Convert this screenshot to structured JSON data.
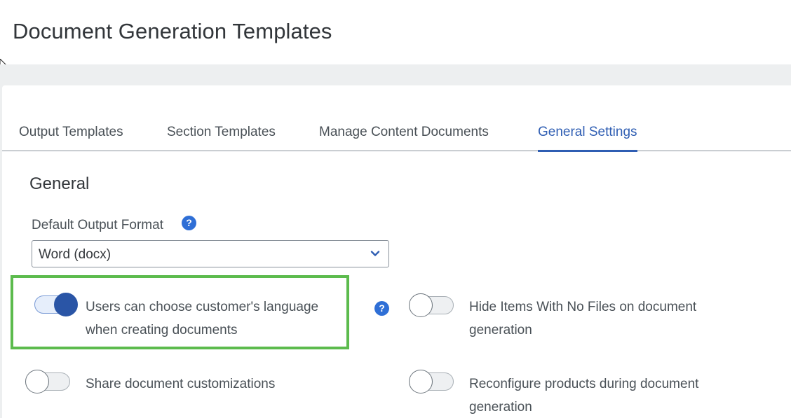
{
  "page": {
    "title": "Document Generation Templates"
  },
  "tabs": [
    {
      "label": "Output Templates",
      "active": false
    },
    {
      "label": "Section Templates",
      "active": false
    },
    {
      "label": "Manage Content Documents",
      "active": false
    },
    {
      "label": "General Settings",
      "active": true
    }
  ],
  "general": {
    "section_title": "General",
    "default_output_format": {
      "label": "Default Output Format",
      "value": "Word (docx)"
    },
    "options": {
      "choose_language": {
        "line1": "Users can choose customer's language",
        "line2": "when creating documents",
        "enabled": true
      },
      "hide_items": {
        "line1": "Hide Items With No Files on document",
        "line2": "generation",
        "enabled": false
      },
      "share_customizations": {
        "line1": "Share document customizations",
        "enabled": false
      },
      "reconfigure_products": {
        "line1": "Reconfigure products during document",
        "line2": "generation",
        "enabled": false
      }
    }
  },
  "colors": {
    "accent": "#2f5eb3",
    "highlight": "#5cbb4d",
    "switch_on": "#2a55a6"
  }
}
